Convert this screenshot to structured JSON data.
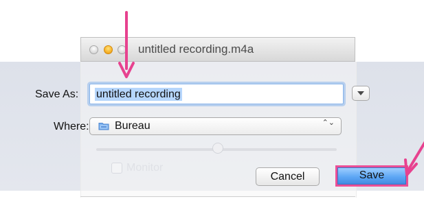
{
  "window": {
    "title": "untitled recording.m4a"
  },
  "dialog": {
    "save_as_label": "Save As:",
    "filename_value": "untitled recording",
    "where_label": "Where:",
    "where_value": "Bureau",
    "select_arrows": "⌃⌄",
    "cancel_label": "Cancel",
    "save_label": "Save"
  },
  "background_controls": {
    "monitor_label": "Monitor"
  },
  "annotation": {
    "arrow_color": "#e7428f",
    "save_highlight_color": "#ea4f97"
  },
  "icons": {
    "expand": "triangle-down-icon",
    "folder": "folder-icon",
    "traffic_lights": [
      "close-icon",
      "minimize-icon",
      "zoom-icon"
    ]
  }
}
